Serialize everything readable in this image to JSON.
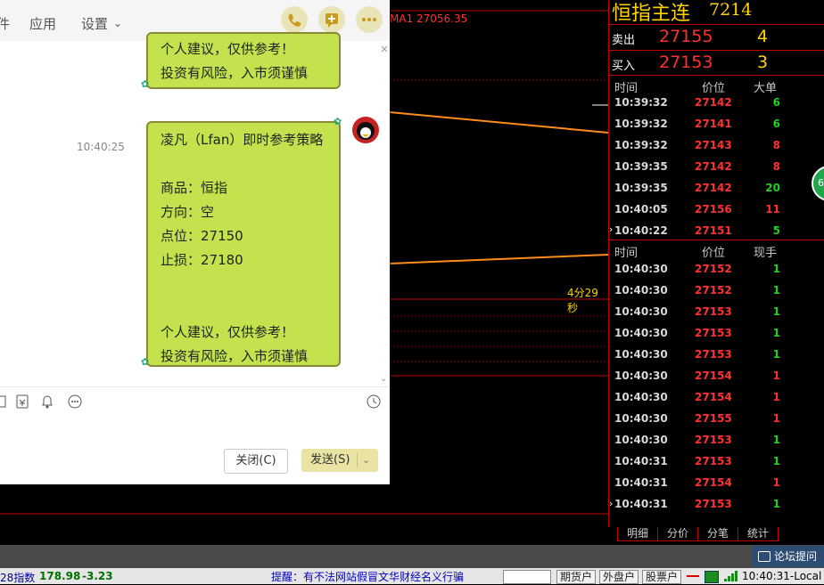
{
  "chart": {
    "ma_label": "MA1 27056.35",
    "timer": "4分29秒"
  },
  "chat": {
    "menu": [
      "件",
      "应用",
      "设置"
    ],
    "timestamp": "10:40:25",
    "top_bubble_lines": [
      "个人建议，仅供参考！",
      "投资有风险，入市须谨慎"
    ],
    "main_bubble_lines": [
      "凌凡（Lfan）即时参考策略",
      "",
      "商品：恒指",
      "方向：空",
      "点位：27150",
      "止损：27180",
      "",
      "",
      "个人建议，仅供参考！",
      "投资有风险，入市须谨慎"
    ],
    "close_button": "关闭(C)",
    "send_button": "发送(S)"
  },
  "panel": {
    "title": "恒指主连",
    "code": "7214",
    "sell_label": "卖出",
    "sell_price": "27155",
    "sell_vol": "4",
    "buy_label": "买入",
    "buy_price": "27153",
    "buy_vol": "3",
    "big_header": [
      "时间",
      "价位",
      "大单"
    ],
    "big_rows": [
      {
        "time": "10:39:32",
        "price": "27142",
        "vol": "6",
        "color": "green"
      },
      {
        "time": "10:39:32",
        "price": "27141",
        "vol": "6",
        "color": "green"
      },
      {
        "time": "10:39:32",
        "price": "27143",
        "vol": "8",
        "color": "red"
      },
      {
        "time": "10:39:35",
        "price": "27142",
        "vol": "8",
        "color": "red"
      },
      {
        "time": "10:39:35",
        "price": "27142",
        "vol": "20",
        "color": "green"
      },
      {
        "time": "10:40:05",
        "price": "27156",
        "vol": "11",
        "color": "red"
      },
      {
        "time": "10:40:22",
        "price": "27151",
        "vol": "5",
        "color": "green"
      }
    ],
    "tick_header": [
      "时间",
      "价位",
      "现手"
    ],
    "tick_rows": [
      {
        "time": "10:40:30",
        "price": "27152",
        "vol": "1",
        "color": "green"
      },
      {
        "time": "10:40:30",
        "price": "27152",
        "vol": "1",
        "color": "green"
      },
      {
        "time": "10:40:30",
        "price": "27153",
        "vol": "1",
        "color": "green"
      },
      {
        "time": "10:40:30",
        "price": "27153",
        "vol": "1",
        "color": "green"
      },
      {
        "time": "10:40:30",
        "price": "27153",
        "vol": "1",
        "color": "green"
      },
      {
        "time": "10:40:30",
        "price": "27154",
        "vol": "1",
        "color": "red"
      },
      {
        "time": "10:40:30",
        "price": "27154",
        "vol": "1",
        "color": "red"
      },
      {
        "time": "10:40:30",
        "price": "27155",
        "vol": "1",
        "color": "red"
      },
      {
        "time": "10:40:30",
        "price": "27153",
        "vol": "1",
        "color": "green"
      },
      {
        "time": "10:40:31",
        "price": "27153",
        "vol": "1",
        "color": "green"
      },
      {
        "time": "10:40:31",
        "price": "27154",
        "vol": "1",
        "color": "red"
      },
      {
        "time": "10:40:31",
        "price": "27153",
        "vol": "1",
        "color": "green"
      }
    ],
    "tabs": [
      "明细",
      "分价",
      "分笔",
      "统计"
    ],
    "side_badge": "6"
  },
  "bottom": {
    "forum": "论坛提问",
    "index_name": "28指数",
    "index_value": "178.98",
    "index_change": "-3.23",
    "notice": "提醒：有不法网站假冒文华财经名义行骗",
    "btn_futures": "期货户",
    "btn_foreign": "外盘户",
    "btn_stock": "股票户",
    "clock": "10:40:31-Local"
  }
}
